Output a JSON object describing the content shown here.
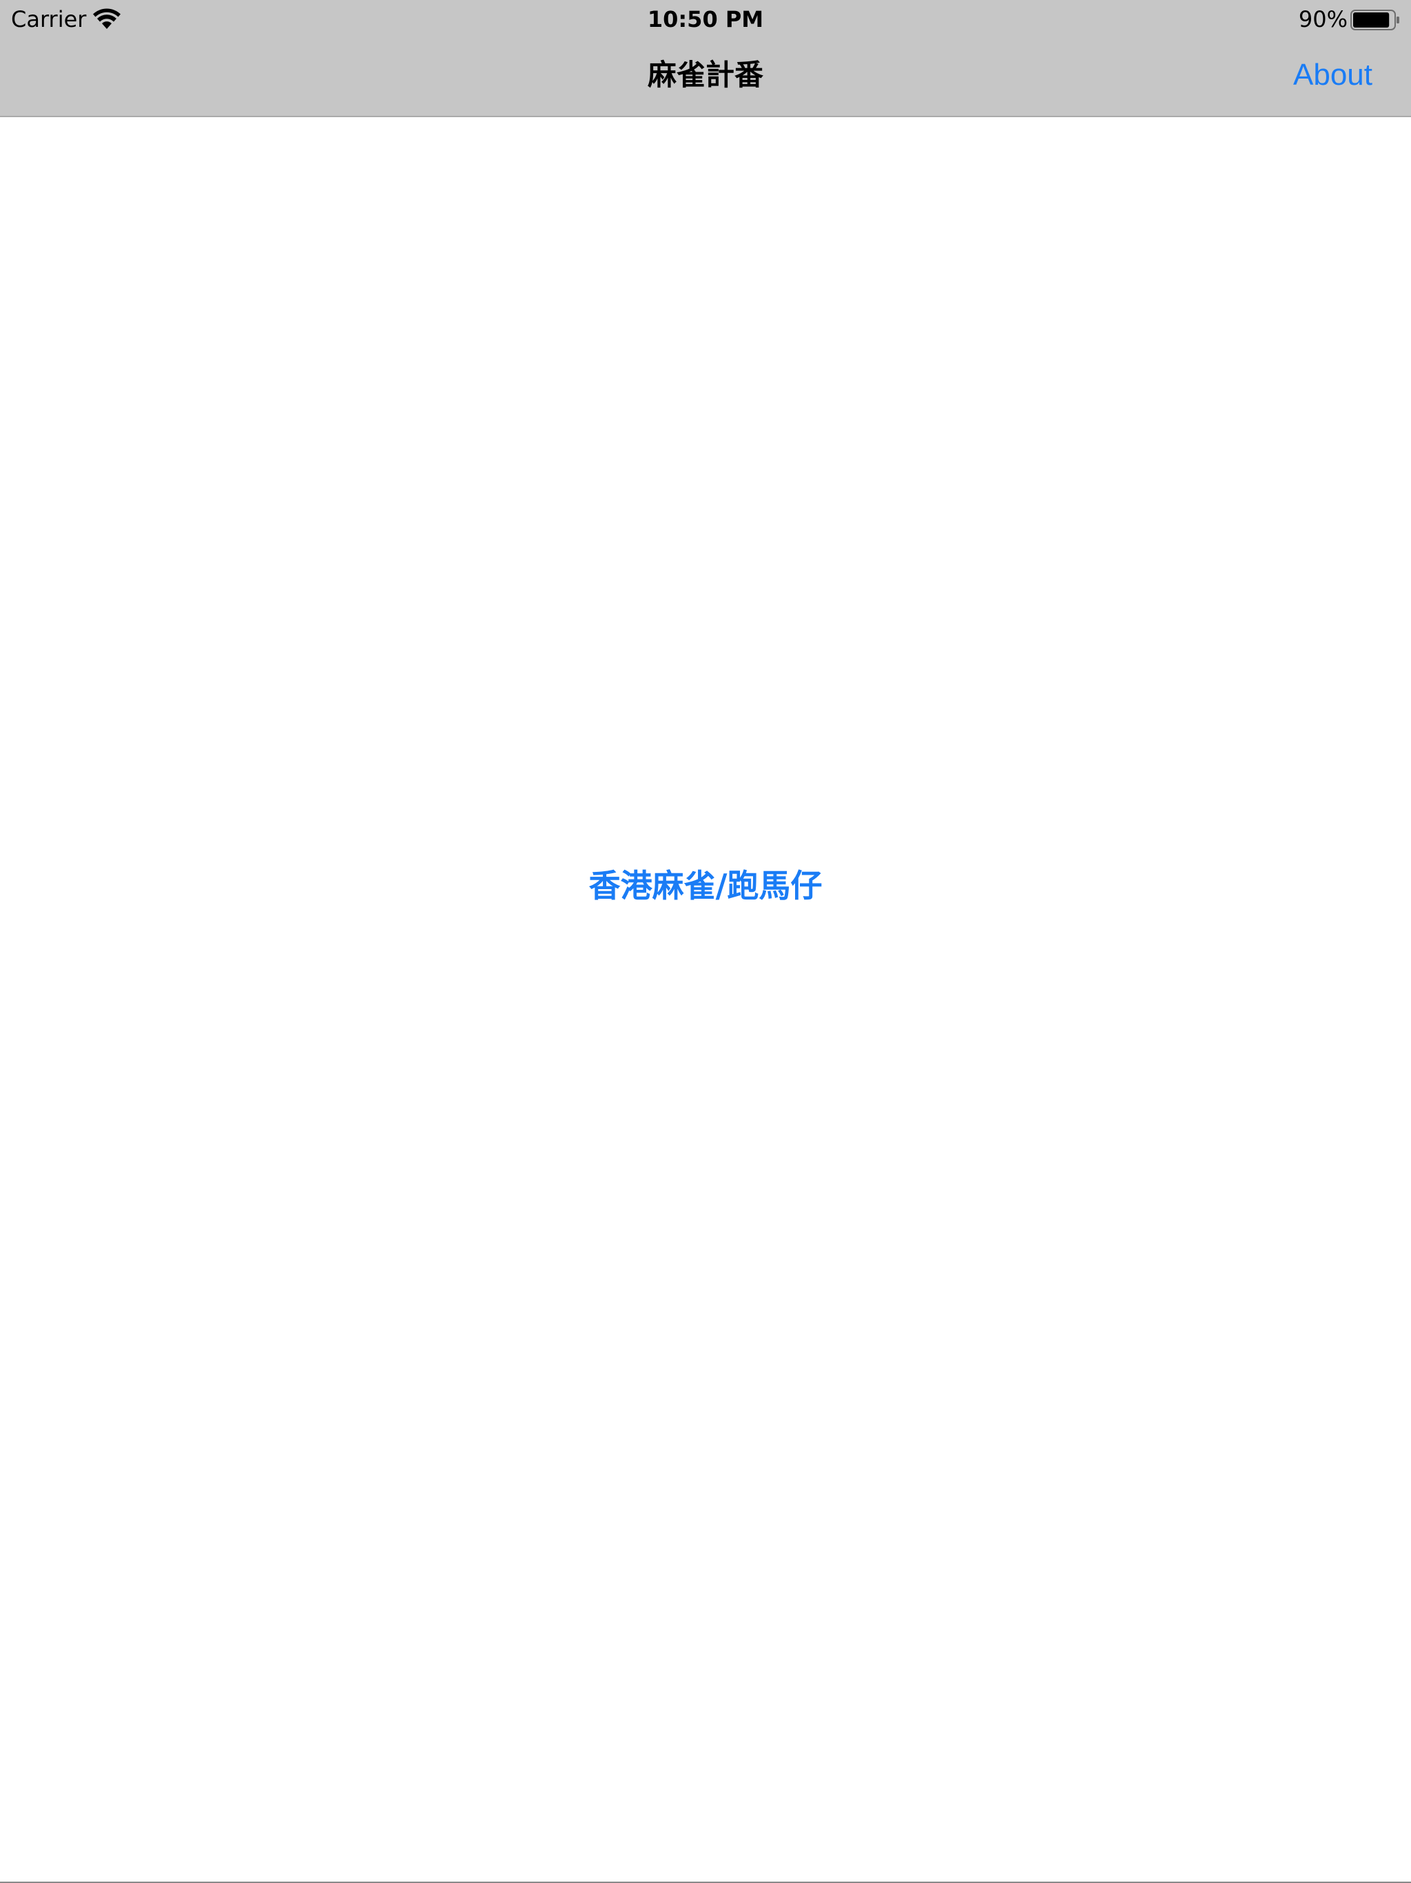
{
  "status_bar": {
    "carrier": "Carrier",
    "time": "10:50 PM",
    "battery_percent": "90%",
    "battery_level": 0.9,
    "wifi_icon": "wifi-icon",
    "battery_icon": "battery-icon"
  },
  "nav_bar": {
    "title": "麻雀計番",
    "about_label": "About"
  },
  "main": {
    "mode_label": "香港麻雀/跑馬仔"
  },
  "colors": {
    "accent": "#1a7cf5",
    "nav_background": "#c6c6c6",
    "background": "#ffffff"
  }
}
